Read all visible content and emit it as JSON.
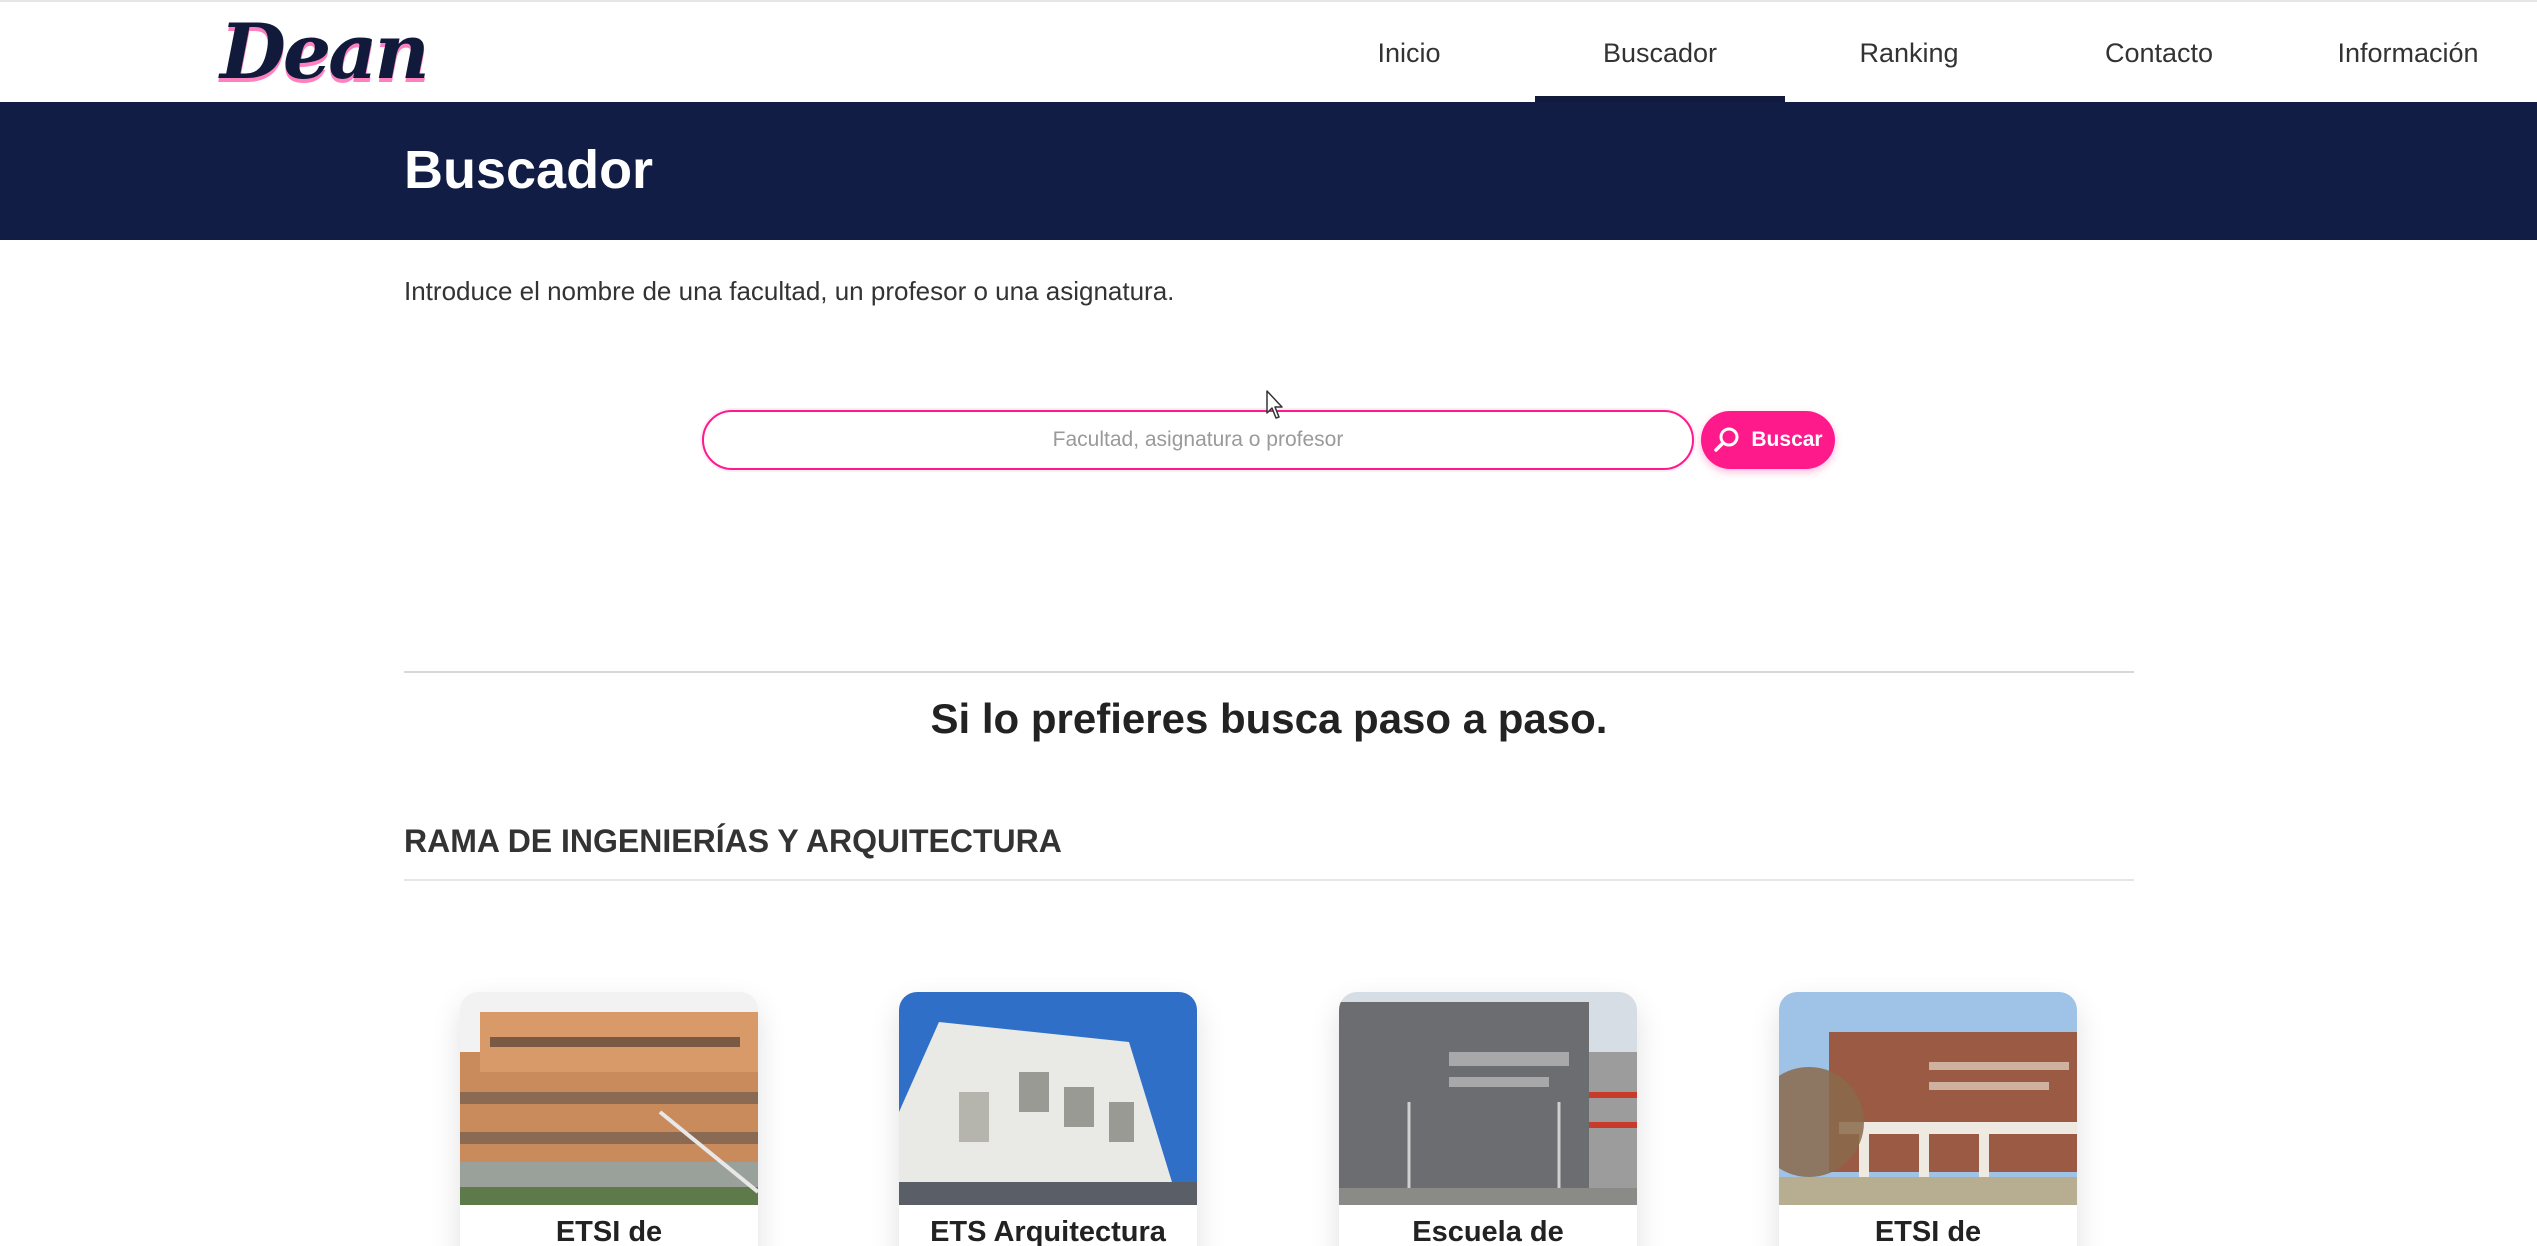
{
  "header": {
    "logo_text": "Dean",
    "nav": [
      {
        "label": "Inicio",
        "active": false
      },
      {
        "label": "Buscador",
        "active": true
      },
      {
        "label": "Ranking",
        "active": false
      },
      {
        "label": "Contacto",
        "active": false
      },
      {
        "label": "Información",
        "active": false
      }
    ]
  },
  "banner": {
    "title": "Buscador",
    "color": "#111d45"
  },
  "search": {
    "intro": "Introduce el nombre de una facultad, un profesor o una asignatura.",
    "placeholder": "Facultad, asignatura o profesor",
    "value": "",
    "button_label": "Buscar",
    "button_icon": "search-icon",
    "accent": "#ff1a8c"
  },
  "section": {
    "title": "Si lo prefieres busca paso a paso.",
    "branch": "RAMA DE INGENIERÍAS Y ARQUITECTURA",
    "cards": [
      {
        "label": "ETSI de"
      },
      {
        "label": "ETS Arquitectura"
      },
      {
        "label": "Escuela de"
      },
      {
        "label": "ETSI de"
      }
    ]
  }
}
